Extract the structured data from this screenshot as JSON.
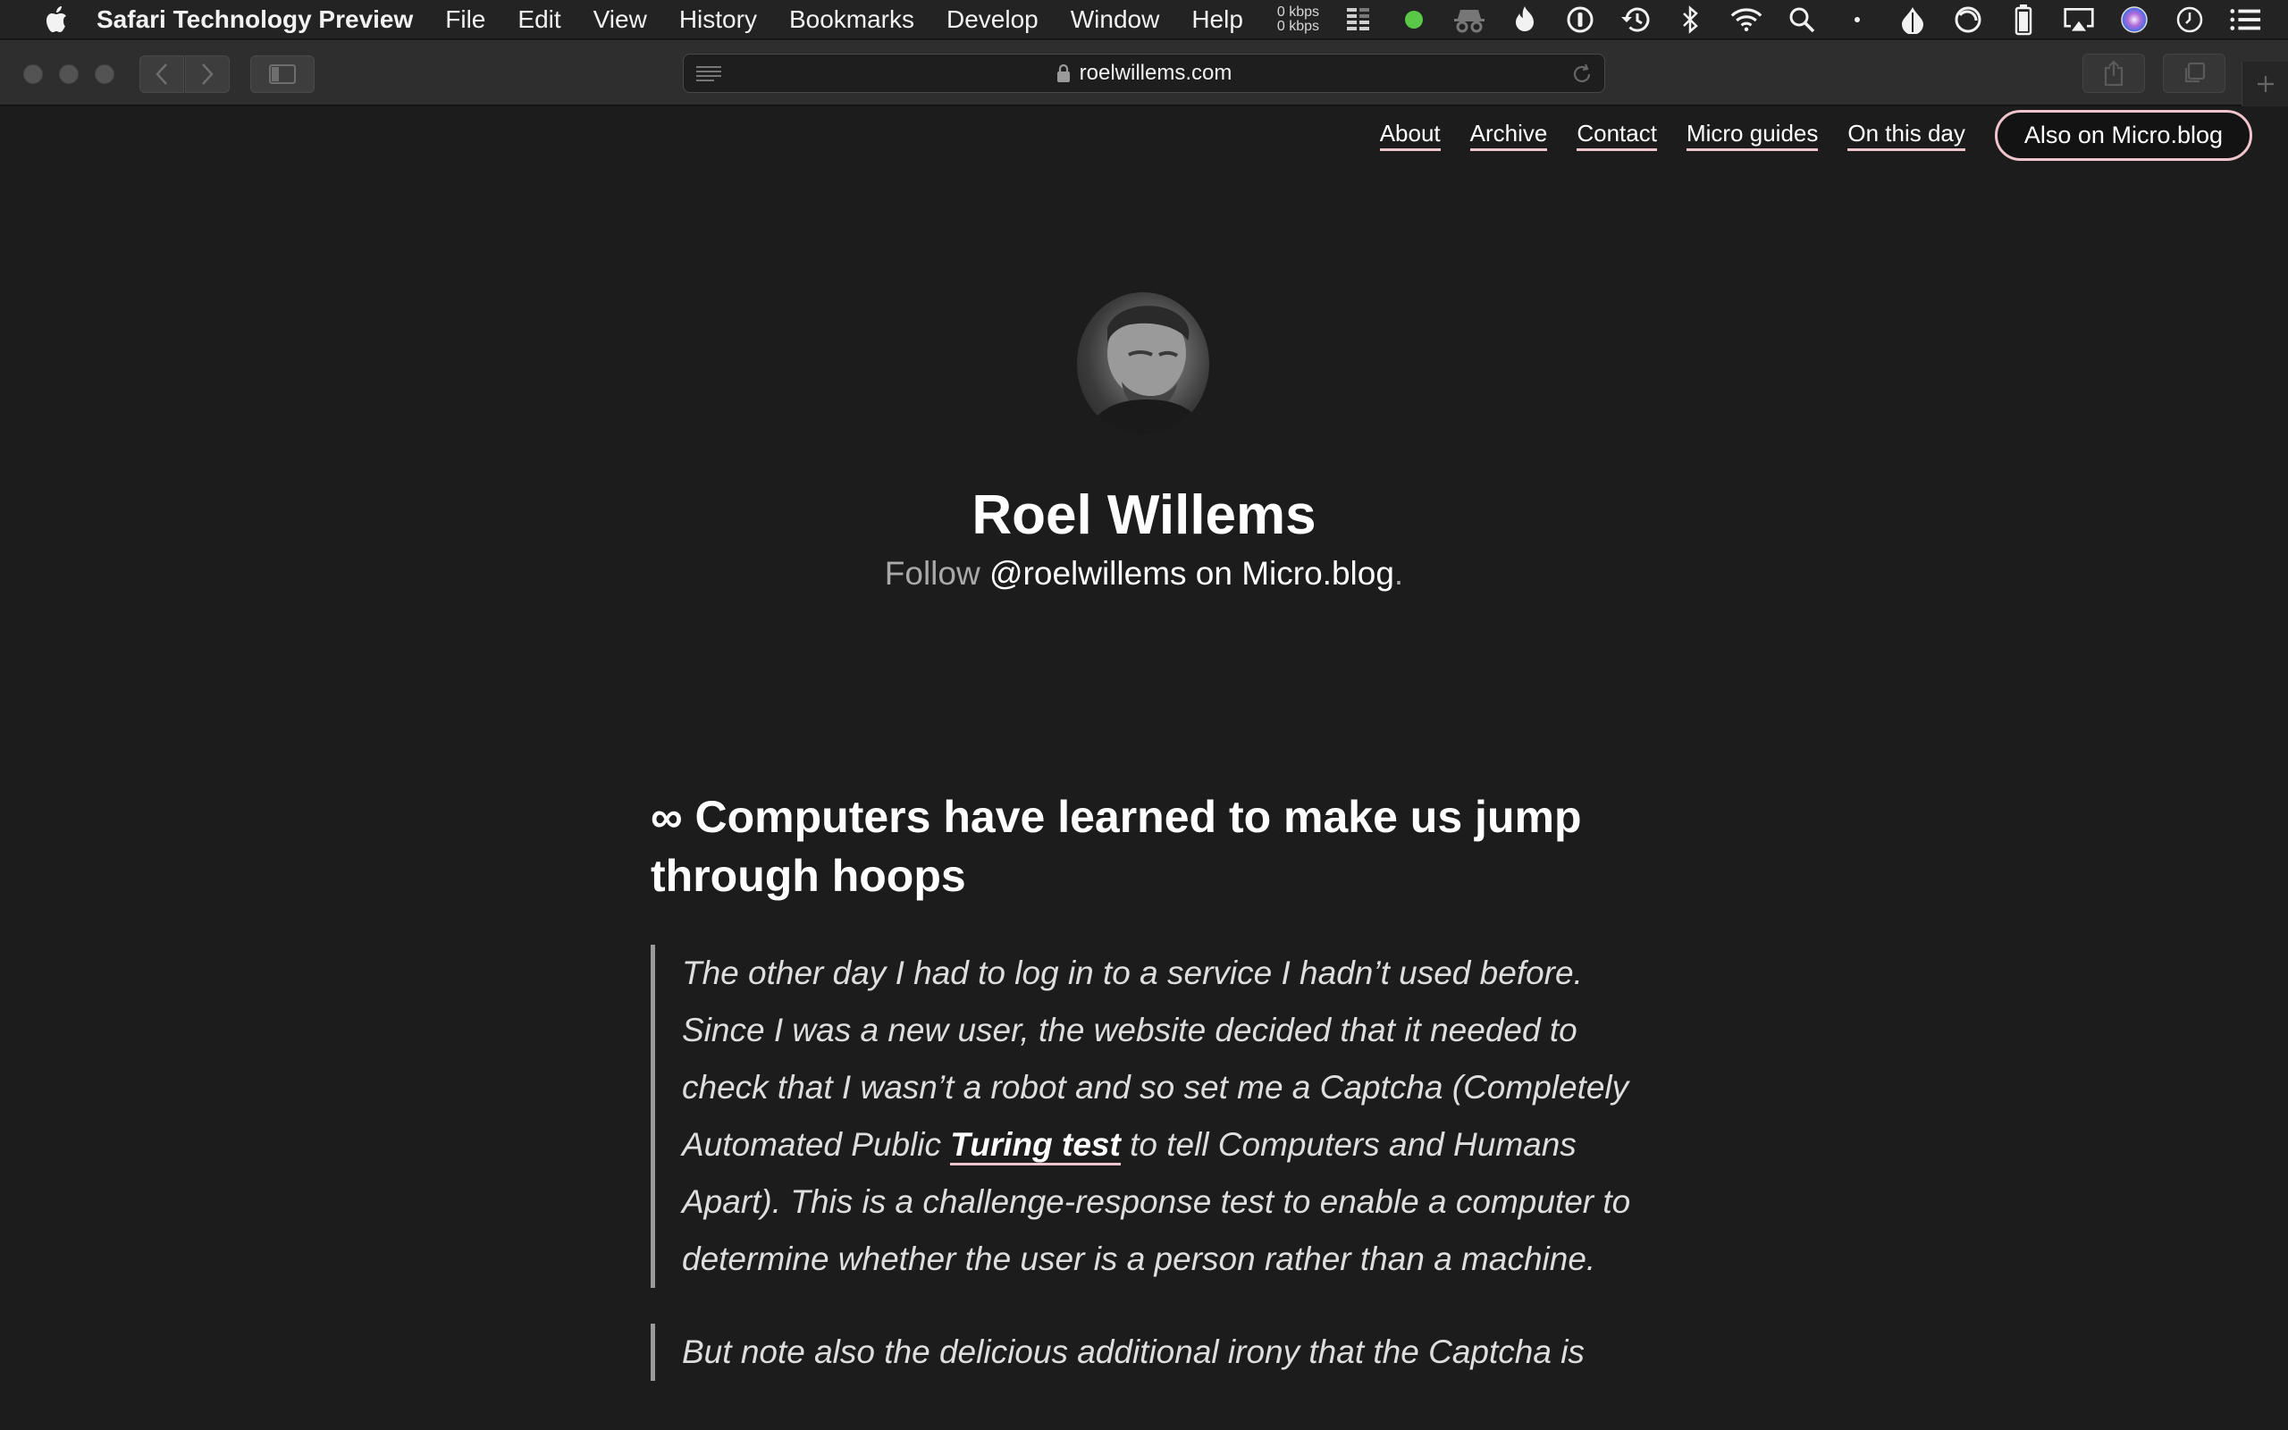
{
  "menubar": {
    "app_name": "Safari Technology Preview",
    "items": [
      "File",
      "Edit",
      "View",
      "History",
      "Bookmarks",
      "Develop",
      "Window",
      "Help"
    ],
    "net_up": "0 kbps",
    "net_down": "0 kbps"
  },
  "toolbar": {
    "url": "roelwillems.com"
  },
  "site_nav": {
    "links": [
      "About",
      "Archive",
      "Contact",
      "Micro guides",
      "On this day"
    ],
    "microblog_button": "Also on Micro.blog"
  },
  "header": {
    "title": "Roel Willems",
    "follow_prefix": "Follow",
    "follow_handle": "@roelwillems on Micro.blog",
    "follow_suffix": "."
  },
  "post": {
    "title": "∞ Computers have learned to make us jump through hoops",
    "quote1_before": "The other day I had to log in to a service I hadn’t used before. Since I was a new user, the website decided that it needed to check that I wasn’t a robot and so set me a Captcha (Completely Automated Public ",
    "quote1_link": "Turing test",
    "quote1_after": " to tell Computers and Humans Apart). This is a challenge-response test to enable a computer to determine whether the user is a person rather than a machine.",
    "quote2": "But note also the delicious additional irony that the Captcha is"
  },
  "colors": {
    "accent_underline": "#f0c6cc",
    "page_background": "#1c1c1c",
    "status_green": "#5ac846"
  },
  "icons": [
    "apple-icon",
    "cpu-meter-icon",
    "status-dot-icon",
    "incognito-icon",
    "flame-icon",
    "onepassword-icon",
    "time-machine-icon",
    "bluetooth-icon",
    "wifi-icon",
    "spotlight-icon",
    "dot-icon",
    "drop-icon",
    "do-not-disturb-icon",
    "battery-icon",
    "airplay-icon",
    "siri-icon",
    "clock-icon",
    "notification-list-icon"
  ]
}
